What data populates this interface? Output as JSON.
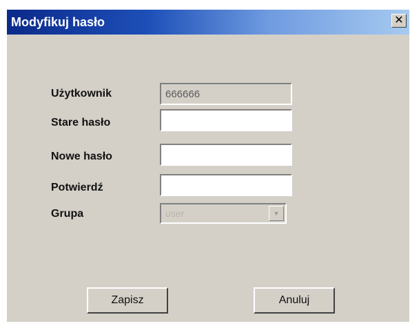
{
  "dialog": {
    "title": "Modyfikuj hasło",
    "close_glyph": "✕"
  },
  "form": {
    "user_label": "Użytkownik",
    "user_value": "666666",
    "old_password_label": "Stare hasło",
    "old_password_value": "",
    "new_password_label": "Nowe hasło",
    "new_password_value": "",
    "confirm_label": "Potwierdź",
    "confirm_value": "",
    "group_label": "Grupa",
    "group_value": "user",
    "group_arrow_glyph": "▼"
  },
  "buttons": {
    "save_label": "Zapisz",
    "cancel_label": "Anuluj"
  },
  "colors": {
    "title_bar_start": "#0b2a8a",
    "title_bar_end": "#a6caf0",
    "dialog_background": "#d4d0c8"
  }
}
